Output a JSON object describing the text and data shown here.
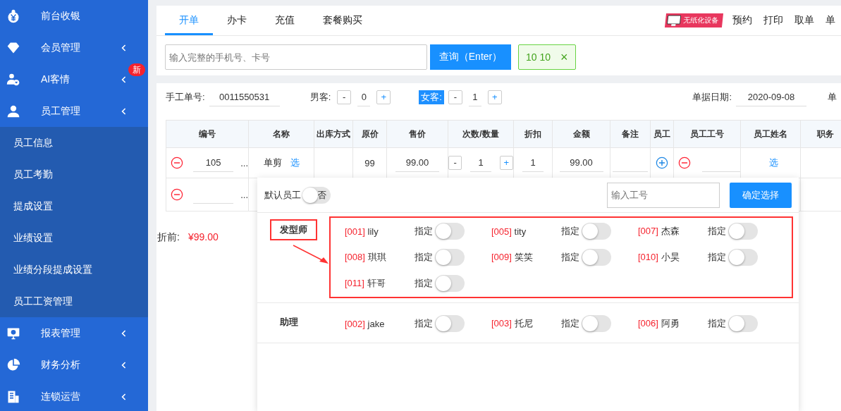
{
  "sidebar": {
    "items": [
      {
        "label": "前台收银",
        "has_submenu": false,
        "expanded": false
      },
      {
        "label": "会员管理",
        "has_submenu": true,
        "expanded": false
      },
      {
        "label": "AI客情",
        "has_submenu": true,
        "expanded": false,
        "badge": "新"
      },
      {
        "label": "员工管理",
        "has_submenu": true,
        "expanded": true,
        "children": [
          {
            "label": "员工信息"
          },
          {
            "label": "员工考勤"
          },
          {
            "label": "提成设置"
          },
          {
            "label": "业绩设置"
          },
          {
            "label": "业绩分段提成设置"
          },
          {
            "label": "员工工资管理"
          }
        ]
      },
      {
        "label": "报表管理",
        "has_submenu": true,
        "expanded": false
      },
      {
        "label": "财务分析",
        "has_submenu": true,
        "expanded": false
      },
      {
        "label": "连锁运营",
        "has_submenu": true,
        "expanded": false
      }
    ]
  },
  "tabs": [
    {
      "label": "开单",
      "selected": true
    },
    {
      "label": "办卡",
      "selected": false
    },
    {
      "label": "充值",
      "selected": false
    },
    {
      "label": "套餐购买",
      "selected": false
    }
  ],
  "header_actions": {
    "promo": "无纸化设备",
    "links": [
      "预约",
      "打印",
      "取单",
      "单"
    ]
  },
  "search": {
    "placeholder": "输入完整的手机号、卡号",
    "button": "查询（Enter）",
    "customer_chip": "10 10",
    "chip_close": "×"
  },
  "order": {
    "manual_no_label": "手工单号:",
    "manual_no": "0011550531",
    "guests": [
      {
        "label": "男客:",
        "count": "0",
        "highlighted": false
      },
      {
        "label": "女客:",
        "count": "1",
        "highlighted": true
      }
    ],
    "minus": "-",
    "plus": "+",
    "date_label": "单据日期:",
    "date": "2020-09-08",
    "extra_label": "单"
  },
  "table": {
    "columns": [
      "编号",
      "名称",
      "出库方式",
      "原价",
      "售价",
      "次数/数量",
      "折扣",
      "金额",
      "备注",
      "员工",
      "员工工号",
      "员工姓名",
      "职务"
    ],
    "rows": [
      {
        "code": "105",
        "more": "...",
        "name": "单剪",
        "pick": "选",
        "orig_price": "99",
        "price": "99.00",
        "qty": "1",
        "discount": "1",
        "amount": "99.00",
        "note": "",
        "staff_no": "",
        "staff_pick": "选"
      },
      {
        "code": "",
        "more": "..."
      }
    ]
  },
  "summary": {
    "label": "折前:",
    "value": "¥99.00"
  },
  "staff_popup": {
    "default_label": "默认员工",
    "default_on": false,
    "default_off_text": "否",
    "search_placeholder": "输入工号",
    "confirm": "确定选择",
    "groups": [
      {
        "name": "发型师",
        "annotated": true,
        "staff": [
          {
            "code": "[001]",
            "name": "lily",
            "assign_label": "指定",
            "assigned": false
          },
          {
            "code": "[005]",
            "name": "tity",
            "assign_label": "指定",
            "assigned": false
          },
          {
            "code": "[007]",
            "name": "杰森",
            "assign_label": "指定",
            "assigned": false
          },
          {
            "code": "[008]",
            "name": "琪琪",
            "assign_label": "指定",
            "assigned": false
          },
          {
            "code": "[009]",
            "name": "笑笑",
            "assign_label": "指定",
            "assigned": false
          },
          {
            "code": "[010]",
            "name": "小昊",
            "assign_label": "指定",
            "assigned": false
          },
          {
            "code": "[011]",
            "name": "轩哥",
            "assign_label": "指定",
            "assigned": false
          }
        ]
      },
      {
        "name": "助理",
        "annotated": false,
        "staff": [
          {
            "code": "[002]",
            "name": "jake",
            "assign_label": "指定",
            "assigned": false
          },
          {
            "code": "[003]",
            "name": "托尼",
            "assign_label": "指定",
            "assigned": false
          },
          {
            "code": "[006]",
            "name": "阿勇",
            "assign_label": "指定",
            "assigned": false
          }
        ]
      }
    ]
  }
}
